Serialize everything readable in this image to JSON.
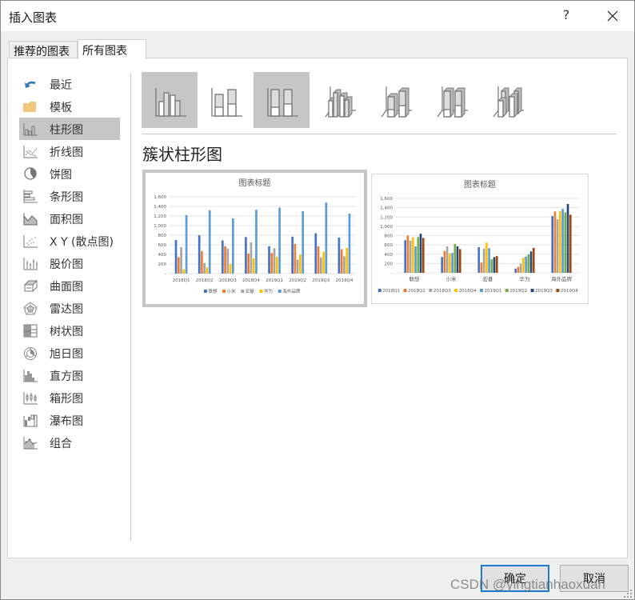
{
  "window": {
    "title": "插入图表",
    "help_label": "?",
    "close_icon": "close-icon"
  },
  "tabs": [
    {
      "label": "推荐的图表",
      "active": false
    },
    {
      "label": "所有图表",
      "active": true
    }
  ],
  "sidebar": {
    "items": [
      {
        "label": "最近",
        "icon": "undo-arrow-icon",
        "selected": false
      },
      {
        "label": "模板",
        "icon": "folder-icon",
        "selected": false
      },
      {
        "label": "柱形图",
        "icon": "column-chart-icon",
        "selected": true
      },
      {
        "label": "折线图",
        "icon": "line-chart-icon",
        "selected": false
      },
      {
        "label": "饼图",
        "icon": "pie-chart-icon",
        "selected": false
      },
      {
        "label": "条形图",
        "icon": "bar-chart-icon",
        "selected": false
      },
      {
        "label": "面积图",
        "icon": "area-chart-icon",
        "selected": false
      },
      {
        "label": "X Y (散点图)",
        "icon": "scatter-chart-icon",
        "selected": false
      },
      {
        "label": "股价图",
        "icon": "stock-chart-icon",
        "selected": false
      },
      {
        "label": "曲面图",
        "icon": "surface-chart-icon",
        "selected": false
      },
      {
        "label": "雷达图",
        "icon": "radar-chart-icon",
        "selected": false
      },
      {
        "label": "树状图",
        "icon": "treemap-chart-icon",
        "selected": false
      },
      {
        "label": "旭日图",
        "icon": "sunburst-chart-icon",
        "selected": false
      },
      {
        "label": "直方图",
        "icon": "histogram-chart-icon",
        "selected": false
      },
      {
        "label": "箱形图",
        "icon": "box-whisker-chart-icon",
        "selected": false
      },
      {
        "label": "瀑布图",
        "icon": "waterfall-chart-icon",
        "selected": false
      },
      {
        "label": "组合",
        "icon": "combo-chart-icon",
        "selected": false
      }
    ]
  },
  "subtypes": [
    {
      "name": "clustered-column",
      "icon": "clustered-column-icon",
      "selected": true
    },
    {
      "name": "stacked-column",
      "icon": "stacked-column-icon",
      "selected": false
    },
    {
      "name": "100-stacked-column",
      "icon": "100-stacked-column-icon",
      "selected": false,
      "hovered": true
    },
    {
      "name": "3d-clustered-column",
      "icon": "3d-clustered-column-icon",
      "selected": false
    },
    {
      "name": "3d-stacked-column",
      "icon": "3d-stacked-column-icon",
      "selected": false
    },
    {
      "name": "3d-100-stacked-column",
      "icon": "3d-100-stacked-column-icon",
      "selected": false
    },
    {
      "name": "3d-column",
      "icon": "3d-column-icon",
      "selected": false
    }
  ],
  "subtype_title": "簇状柱形图",
  "buttons": {
    "ok": "确定",
    "cancel": "取消"
  },
  "watermark": "CSDN @yingtianhaoxuan",
  "colors": {
    "series": [
      "#4472c4",
      "#ed7d31",
      "#a5a5a5",
      "#ffc000",
      "#5b9bd5",
      "#70ad47",
      "#264478",
      "#9e480e"
    ],
    "selected_bg": "#c6c6c6",
    "ok_border": "#1a7bd1"
  },
  "chart_data": [
    {
      "type": "bar",
      "title": "图表标题",
      "xlabel": "",
      "ylabel": "",
      "ylim": [
        0,
        1600
      ],
      "yticks": [
        "-",
        "200",
        "400",
        "600",
        "800",
        "1,000",
        "1,200",
        "1,400",
        "1,600"
      ],
      "grid": true,
      "legend": "bottom",
      "categories": [
        "2018Q1",
        "2018Q2",
        "2018Q3",
        "2018Q4",
        "2019Q1",
        "2019Q2",
        "2019Q3",
        "2019Q4"
      ],
      "series": [
        {
          "name": "联想",
          "values": [
            700,
            800,
            690,
            760,
            570,
            770,
            840,
            750
          ]
        },
        {
          "name": "小米",
          "values": [
            340,
            470,
            570,
            420,
            430,
            620,
            570,
            510
          ]
        },
        {
          "name": "宏碁",
          "values": [
            550,
            220,
            520,
            650,
            530,
            290,
            340,
            360
          ]
        },
        {
          "name": "华为",
          "values": [
            90,
            130,
            200,
            320,
            350,
            395,
            460,
            535
          ]
        },
        {
          "name": "海外品牌",
          "values": [
            1220,
            1320,
            1150,
            1330,
            1375,
            1300,
            1480,
            1250
          ]
        }
      ]
    },
    {
      "type": "bar",
      "title": "图表标题",
      "xlabel": "",
      "ylabel": "",
      "ylim": [
        0,
        1600
      ],
      "yticks": [
        "-",
        "200",
        "400",
        "600",
        "800",
        "1,000",
        "1,200",
        "1,400",
        "1,600"
      ],
      "grid": true,
      "legend": "bottom",
      "categories": [
        "联想",
        "小米",
        "宏碁",
        "华为",
        "海外品牌"
      ],
      "series": [
        {
          "name": "2018Q1",
          "values": [
            700,
            340,
            550,
            90,
            1220
          ]
        },
        {
          "name": "2018Q2",
          "values": [
            800,
            470,
            220,
            130,
            1320
          ]
        },
        {
          "name": "2018Q3",
          "values": [
            690,
            570,
            520,
            200,
            1150
          ]
        },
        {
          "name": "2018Q4",
          "values": [
            760,
            420,
            650,
            320,
            1330
          ]
        },
        {
          "name": "2019Q1",
          "values": [
            570,
            430,
            530,
            350,
            1375
          ]
        },
        {
          "name": "2019Q2",
          "values": [
            770,
            620,
            290,
            395,
            1300
          ]
        },
        {
          "name": "2019Q3",
          "values": [
            840,
            570,
            340,
            460,
            1480
          ]
        },
        {
          "name": "2019Q4",
          "values": [
            750,
            510,
            360,
            535,
            1250
          ]
        }
      ]
    }
  ]
}
